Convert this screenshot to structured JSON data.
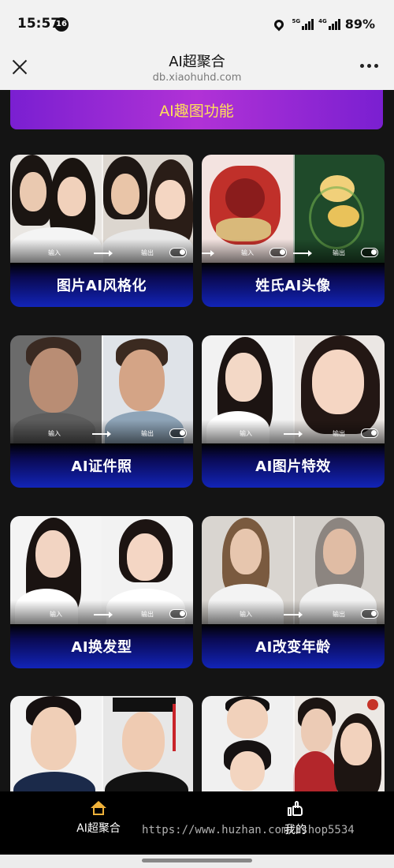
{
  "status_bar": {
    "time": "15:57",
    "notification_count": "16",
    "network_5g": "5G",
    "network_4g": "4G",
    "battery": "89%"
  },
  "header": {
    "title": "AI超聚合",
    "url": "db.xiaohuhd.com"
  },
  "banner": {
    "label": "AI趣图功能"
  },
  "cards": [
    {
      "title": "图片AI风格化",
      "input_label": "输入",
      "output_label": "输出"
    },
    {
      "title": "姓氏AI头像",
      "input_label": "输入",
      "output_label": "输出"
    },
    {
      "title": "AI证件照",
      "input_label": "输入",
      "output_label": "输出"
    },
    {
      "title": "AI图片特效",
      "input_label": "输入",
      "output_label": "输出"
    },
    {
      "title": "AI换发型",
      "input_label": "输入",
      "output_label": "输出"
    },
    {
      "title": "AI改变年龄",
      "input_label": "输入",
      "output_label": "输出"
    }
  ],
  "bottom_nav": {
    "items": [
      {
        "label": "AI超聚合",
        "icon": "home-icon",
        "active": true,
        "color": "#f0b23a"
      },
      {
        "label": "我的",
        "icon": "thumbs-up-icon",
        "active": false
      }
    ]
  },
  "watermark": "https://www.huzhan.com/ishop5534"
}
